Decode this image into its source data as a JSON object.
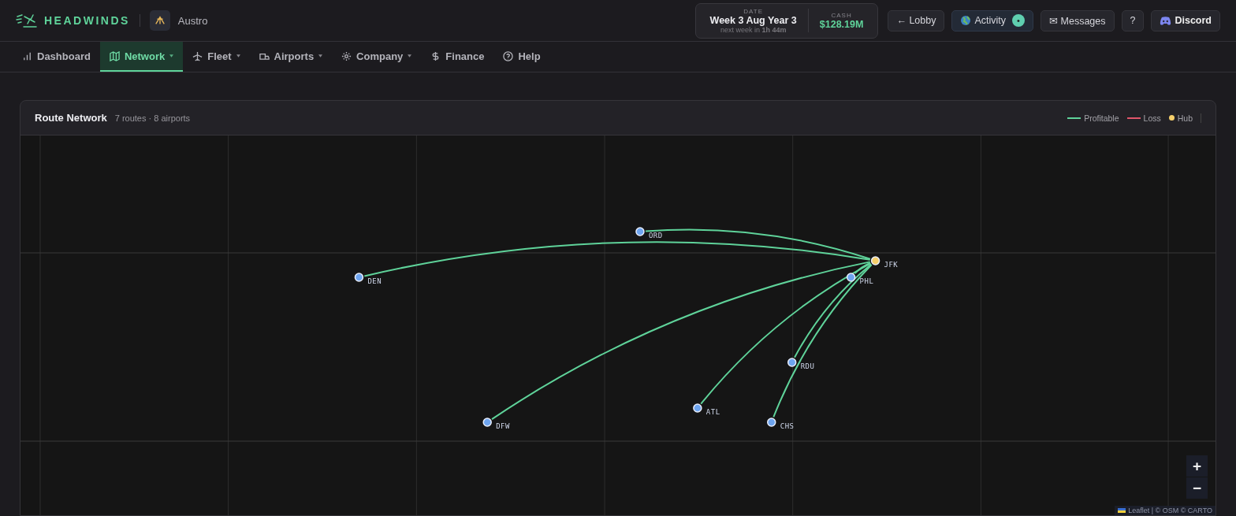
{
  "brand": {
    "name": "HEADWINDS",
    "airline": "Austro"
  },
  "clock": {
    "date_label": "DATE",
    "date": "Week 3 Aug Year 3",
    "next": "next week in **1h 44m**",
    "cash_label": "CASH",
    "cash": "$128.19M"
  },
  "actions": [
    {
      "kind": "plain",
      "label": "← Lobby"
    },
    {
      "kind": "activity",
      "label": "Activity",
      "badge": "•"
    },
    {
      "kind": "plain",
      "label": "✉ Messages"
    },
    {
      "kind": "plain",
      "label": "?"
    },
    {
      "kind": "discord",
      "label": "Discord"
    }
  ],
  "tabs": [
    {
      "label": "Dashboard",
      "selected": false,
      "dropdown": false
    },
    {
      "label": "Network",
      "selected": true,
      "dropdown": true
    },
    {
      "label": "Fleet",
      "selected": false,
      "dropdown": true
    },
    {
      "label": "Airports",
      "selected": false,
      "dropdown": true
    },
    {
      "label": "Company",
      "selected": false,
      "dropdown": true
    },
    {
      "label": "Finance",
      "selected": false,
      "dropdown": false
    },
    {
      "label": "Help",
      "selected": false,
      "dropdown": false
    }
  ],
  "panel": {
    "title": "Route Network",
    "summary": "7 routes · 8 airports",
    "legend": [
      {
        "kind": "line",
        "label": "Profitable",
        "color": "#5fd39a"
      },
      {
        "kind": "line",
        "label": "Loss",
        "color": "#e0566a"
      },
      {
        "kind": "dot",
        "label": "Hub",
        "color": "#f5cf6b"
      }
    ]
  },
  "map": {
    "airports": [
      {
        "code": "ORD",
        "hub": false,
        "profitable": true
      },
      {
        "code": "JFK",
        "hub": true
      },
      {
        "code": "DEN",
        "hub": false,
        "profitable": true
      },
      {
        "code": "PHL",
        "hub": false,
        "profitable": true
      },
      {
        "code": "RDU",
        "hub": false,
        "profitable": true
      },
      {
        "code": "ATL",
        "hub": false,
        "profitable": true
      },
      {
        "code": "CHS",
        "hub": false,
        "profitable": true
      },
      {
        "code": "DFW",
        "hub": false,
        "profitable": true
      }
    ],
    "zoom_in": "+",
    "zoom_out": "−",
    "attribution": "Leaflet | © OSM © CARTO"
  }
}
